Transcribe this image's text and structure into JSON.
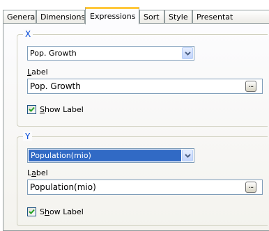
{
  "tabs": [
    {
      "label": "General"
    },
    {
      "label": "Dimensions"
    },
    {
      "label": "Expressions"
    },
    {
      "label": "Sort"
    },
    {
      "label": "Style"
    },
    {
      "label": "Presentat"
    }
  ],
  "active_tab": "Expressions",
  "colors": {
    "accent": "#ffc83c",
    "selection": "#316ac5",
    "group_title": "#0046d5"
  },
  "x_group": {
    "title": "X",
    "combo_value": "Pop. Growth",
    "label_caption": "Label",
    "label_value": "Pop. Growth",
    "browse_label": "...",
    "show_label_text": "Show Label",
    "show_label_checked": true
  },
  "y_group": {
    "title": "Y",
    "combo_value": "Population(mio)",
    "label_caption": "Label",
    "label_value": "Population(mio)",
    "browse_label": "...",
    "show_label_text": "Show Label",
    "show_label_checked": true
  }
}
